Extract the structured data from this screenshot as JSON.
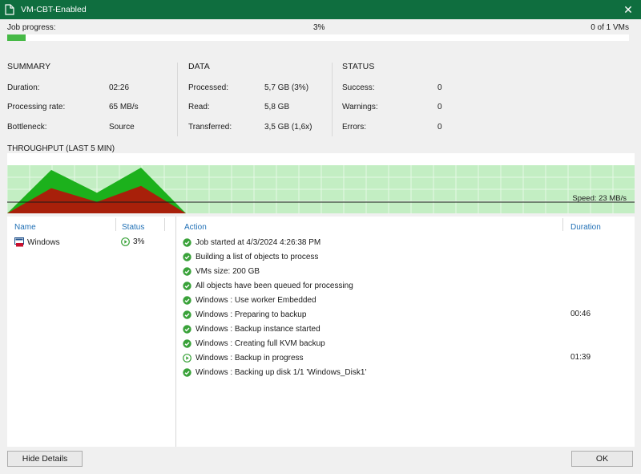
{
  "window": {
    "title": "VM-CBT-Enabled"
  },
  "job": {
    "progress_label": "Job progress:",
    "progress_percent": "3%",
    "progress_value": 3,
    "vm_count": "0 of 1 VMs"
  },
  "summary": {
    "heading": "SUMMARY",
    "duration_label": "Duration:",
    "duration_value": "02:26",
    "rate_label": "Processing rate:",
    "rate_value": "65 MB/s",
    "bottleneck_label": "Bottleneck:",
    "bottleneck_value": "Source"
  },
  "data": {
    "heading": "DATA",
    "processed_label": "Processed:",
    "processed_value": "5,7 GB (3%)",
    "read_label": "Read:",
    "read_value": "5,8 GB",
    "transferred_label": "Transferred:",
    "transferred_value": "3,5 GB (1,6x)"
  },
  "status": {
    "heading": "STATUS",
    "success_label": "Success:",
    "success_value": "0",
    "warnings_label": "Warnings:",
    "warnings_value": "0",
    "errors_label": "Errors:",
    "errors_value": "0"
  },
  "chart_data": {
    "type": "area",
    "title": "THROUGHPUT (LAST 5 MIN)",
    "annotation": "Speed: 23 MB/s",
    "speed_value": 23,
    "series": [
      {
        "values": [
          0,
          0.95,
          0.45,
          1.0,
          0
        ]
      },
      {
        "values": [
          0,
          0.55,
          0.25,
          0.6,
          0
        ]
      }
    ]
  },
  "vm_table": {
    "name_header": "Name",
    "status_header": "Status",
    "rows": [
      {
        "name": "Windows",
        "status": "3%"
      }
    ]
  },
  "actions": {
    "action_header": "Action",
    "duration_header": "Duration",
    "rows": [
      {
        "text": "Job started at 4/3/2024 4:26:38 PM",
        "duration": "",
        "state": "success"
      },
      {
        "text": "Building a list of objects to process",
        "duration": "",
        "state": "success"
      },
      {
        "text": "VMs size: 200 GB",
        "duration": "",
        "state": "success"
      },
      {
        "text": "All objects have been queued for processing",
        "duration": "",
        "state": "success"
      },
      {
        "text": "Windows : Use worker Embedded",
        "duration": "",
        "state": "success"
      },
      {
        "text": "Windows : Preparing to backup",
        "duration": "00:46",
        "state": "success"
      },
      {
        "text": "Windows : Backup instance started",
        "duration": "",
        "state": "success"
      },
      {
        "text": "Windows : Creating full KVM backup",
        "duration": "",
        "state": "success"
      },
      {
        "text": "Windows : Backup in progress",
        "duration": "01:39",
        "state": "running"
      },
      {
        "text": "Windows : Backing up disk 1/1 'Windows_Disk1'",
        "duration": "",
        "state": "success"
      }
    ]
  },
  "buttons": {
    "hide_details": "Hide Details",
    "ok": "OK"
  },
  "colors": {
    "title_bar": "#0f6e3f",
    "progress": "#46b946",
    "chart_bg": "#c3eec3",
    "chart_outer": "#1cb11c",
    "chart_inner": "#a8200a",
    "link": "#1f6fb5"
  }
}
